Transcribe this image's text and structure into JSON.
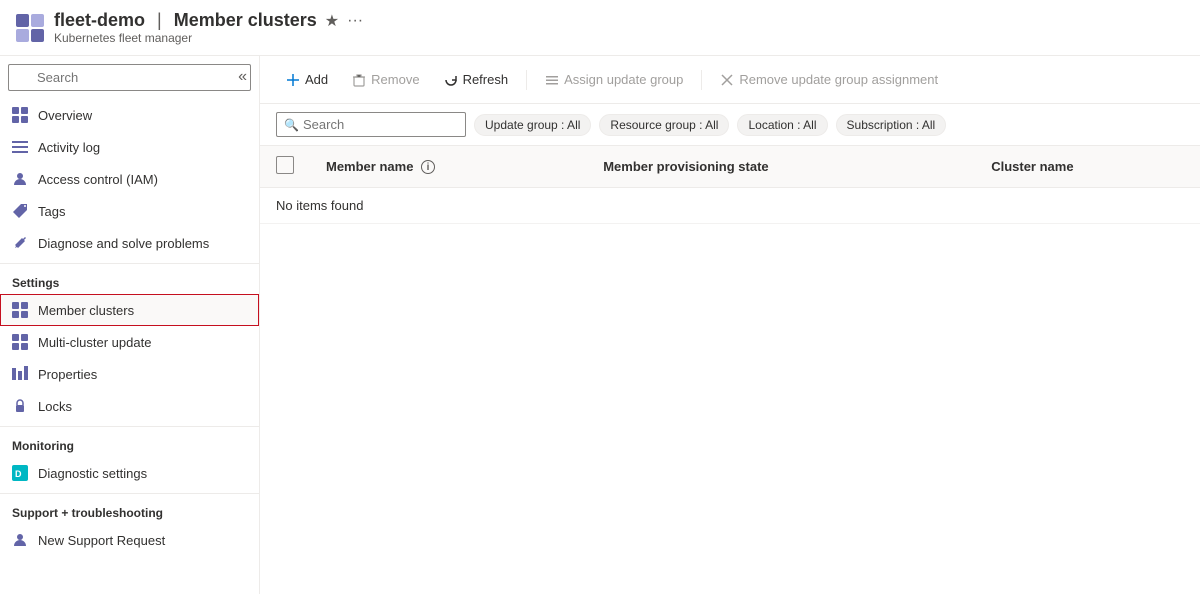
{
  "header": {
    "title": "fleet-demo",
    "separator": "|",
    "page": "Member clusters",
    "subtitle": "Kubernetes fleet manager",
    "star_label": "★",
    "ellipsis_label": "···"
  },
  "sidebar": {
    "search_placeholder": "Search",
    "collapse_icon": "«",
    "nav_items": [
      {
        "id": "overview",
        "label": "Overview",
        "icon": "grid"
      },
      {
        "id": "activity-log",
        "label": "Activity log",
        "icon": "list"
      },
      {
        "id": "access-control",
        "label": "Access control (IAM)",
        "icon": "person"
      },
      {
        "id": "tags",
        "label": "Tags",
        "icon": "tag"
      },
      {
        "id": "diagnose",
        "label": "Diagnose and solve problems",
        "icon": "wrench"
      }
    ],
    "sections": [
      {
        "title": "Settings",
        "items": [
          {
            "id": "member-clusters",
            "label": "Member clusters",
            "icon": "grid",
            "active": true
          },
          {
            "id": "multi-cluster-update",
            "label": "Multi-cluster update",
            "icon": "grid"
          },
          {
            "id": "properties",
            "label": "Properties",
            "icon": "bars"
          },
          {
            "id": "locks",
            "label": "Locks",
            "icon": "lock"
          }
        ]
      },
      {
        "title": "Monitoring",
        "items": [
          {
            "id": "diagnostic-settings",
            "label": "Diagnostic settings",
            "icon": "diagnostic"
          }
        ]
      },
      {
        "title": "Support + troubleshooting",
        "items": [
          {
            "id": "new-support-request",
            "label": "New Support Request",
            "icon": "person"
          }
        ]
      }
    ]
  },
  "toolbar": {
    "add_label": "Add",
    "remove_label": "Remove",
    "refresh_label": "Refresh",
    "assign_label": "Assign update group",
    "remove_assignment_label": "Remove update group assignment"
  },
  "filters": {
    "search_placeholder": "Search",
    "chips": [
      {
        "id": "update-group",
        "label": "Update group : All"
      },
      {
        "id": "resource-group",
        "label": "Resource group : All"
      },
      {
        "id": "location",
        "label": "Location : All"
      },
      {
        "id": "subscription",
        "label": "Subscription : All"
      }
    ]
  },
  "table": {
    "columns": [
      {
        "id": "checkbox",
        "label": ""
      },
      {
        "id": "member-name",
        "label": "Member name",
        "info": true
      },
      {
        "id": "provisioning-state",
        "label": "Member provisioning state"
      },
      {
        "id": "cluster-name",
        "label": "Cluster name"
      }
    ],
    "empty_message": "No items found"
  }
}
